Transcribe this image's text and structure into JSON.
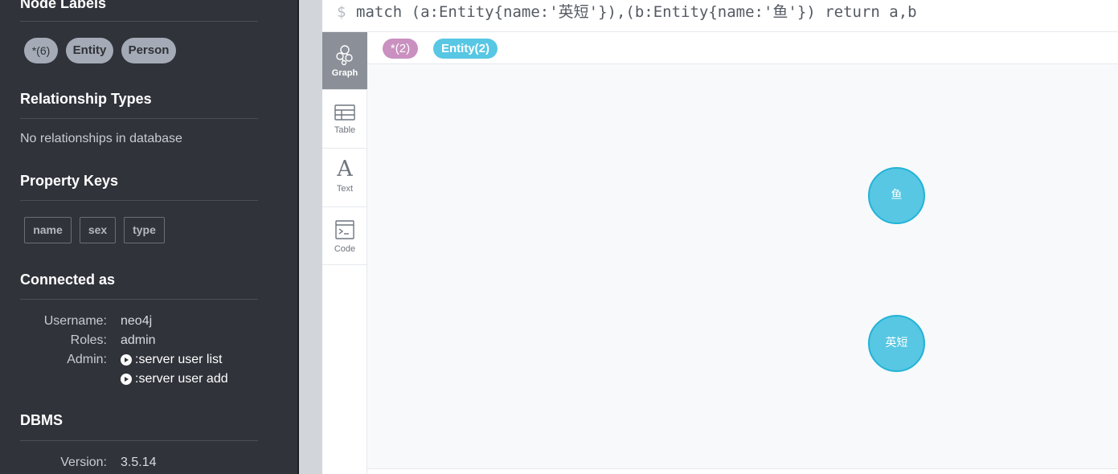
{
  "sidebar": {
    "node_labels_title": "Node Labels",
    "node_labels": [
      "*(6)",
      "Entity",
      "Person"
    ],
    "relationship_types_title": "Relationship Types",
    "no_relationships": "No relationships in database",
    "property_keys_title": "Property Keys",
    "property_keys": [
      "name",
      "sex",
      "type"
    ],
    "connected_title": "Connected as",
    "username_label": "Username:",
    "username": "neo4j",
    "roles_label": "Roles:",
    "roles": "admin",
    "admin_label": "Admin:",
    "admin_commands": [
      ":server user list",
      ":server user add"
    ],
    "dbms_title": "DBMS",
    "version_label": "Version:",
    "version": "3.5.14"
  },
  "editor": {
    "prompt": "$",
    "query": "match (a:Entity{name:'英短'}),(b:Entity{name:'鱼'}) return a,b"
  },
  "view_tabs": [
    {
      "label": "Graph",
      "icon": "graph-icon",
      "active": true
    },
    {
      "label": "Table",
      "icon": "table-icon",
      "active": false
    },
    {
      "label": "Text",
      "icon": "text-icon",
      "active": false
    },
    {
      "label": "Code",
      "icon": "code-icon",
      "active": false
    }
  ],
  "result_labels": [
    {
      "label": "*(2)",
      "color": "#c990c0"
    },
    {
      "label": "Entity(2)",
      "color": "#57c7e3"
    }
  ],
  "graph": {
    "nodes": [
      {
        "caption": "鱼",
        "label": "Entity"
      },
      {
        "caption": "英短",
        "label": "Entity"
      }
    ]
  },
  "colors": {
    "sidebar_bg": "#30333a",
    "node_fill": "#57c7e3",
    "node_border": "#23b3d7",
    "wildcard_chip": "#c990c0"
  }
}
